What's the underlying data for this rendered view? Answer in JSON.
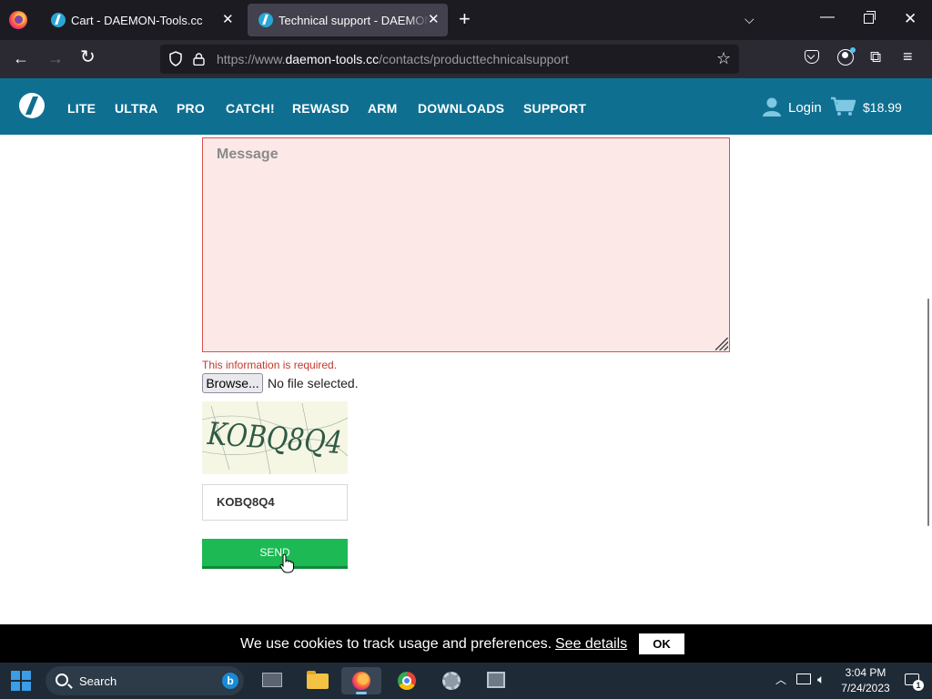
{
  "browser": {
    "tabs": [
      {
        "title": "Cart - DAEMON-Tools.cc",
        "active": false
      },
      {
        "title": "Technical support - DAEMON-Tools.cc",
        "active": true
      }
    ],
    "url_prefix": "https://www.",
    "url_domain": "daemon-tools.cc",
    "url_path": "/contacts/producttechnicalsupport"
  },
  "site": {
    "nav": [
      "LITE",
      "ULTRA",
      "PRO",
      "CATCH!",
      "REWASD",
      "ARM",
      "DOWNLOADS",
      "SUPPORT"
    ],
    "login_label": "Login",
    "cart_total": "$18.99",
    "brand_color": "#0f6f91"
  },
  "form": {
    "message_placeholder": "Message",
    "message_value": "",
    "error_text": "This information is required.",
    "browse_label": "Browse...",
    "file_status": "No file selected.",
    "captcha_text": "KOBQ8Q4",
    "captcha_input_value": "KOBQ8Q4",
    "send_label": "SEND",
    "send_color": "#1db954"
  },
  "cookie": {
    "text": "We use cookies to track usage and preferences.",
    "link": "See details",
    "ok": "OK"
  },
  "taskbar": {
    "search_label": "Search",
    "time": "3:04 PM",
    "date": "7/24/2023",
    "notification_count": "1"
  }
}
